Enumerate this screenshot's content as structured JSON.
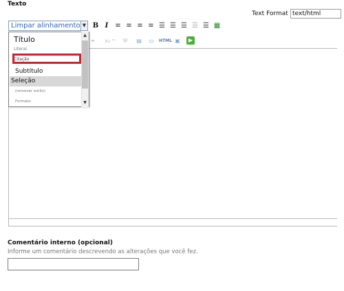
{
  "section_label": "Texto",
  "text_format": {
    "label": "Text Format",
    "value": "text/html"
  },
  "style_combo": {
    "value": "Limpar alinhamento"
  },
  "style_dropdown": {
    "items": [
      "Título",
      "Literal",
      "Citação",
      "Subtítulo",
      "Seleção",
      "(remover estilo)",
      "Formato"
    ],
    "highlighted_item": "Citação",
    "selected_item": "Seleção",
    "highlight_color": "#d0202a"
  },
  "toolbar": {
    "bold": "B",
    "italic": "I",
    "html_label": "HTML"
  },
  "comment": {
    "label": "Comentário interno (opcional)",
    "hint": "Informe um comentário descrevendo as alterações que você fez.",
    "value": ""
  }
}
